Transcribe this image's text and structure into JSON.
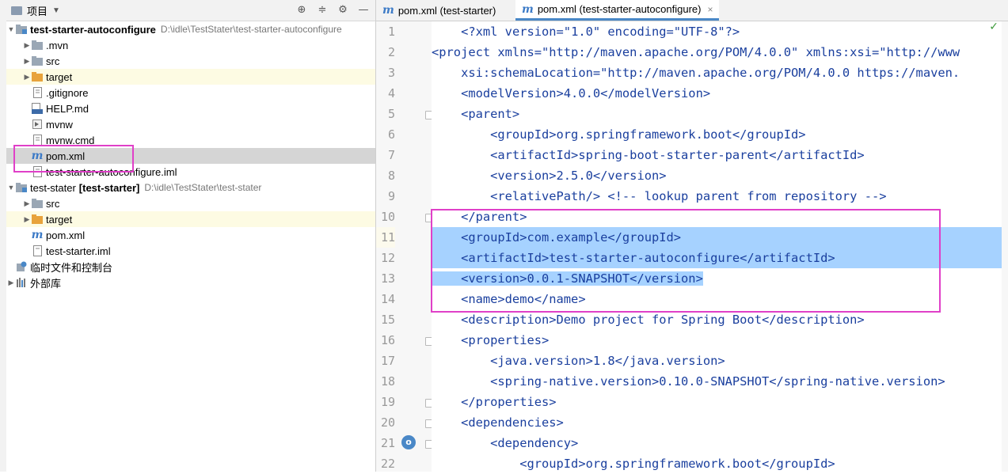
{
  "project_panel": {
    "title": "项目",
    "tree": [
      {
        "label": "test-starter-autoconfigure",
        "path": "D:\\idle\\TestStater\\test-starter-autoconfigure",
        "bold": true
      },
      {
        "label": ".mvn"
      },
      {
        "label": "src"
      },
      {
        "label": "target"
      },
      {
        "label": ".gitignore"
      },
      {
        "label": "HELP.md"
      },
      {
        "label": "mvnw"
      },
      {
        "label": "mvnw.cmd"
      },
      {
        "label": "pom.xml"
      },
      {
        "label": "test-starter-autoconfigure.iml"
      },
      {
        "label": "test-stater",
        "module": "[test-starter]",
        "path": "D:\\idle\\TestStater\\test-stater"
      },
      {
        "label": "src"
      },
      {
        "label": "target"
      },
      {
        "label": "pom.xml"
      },
      {
        "label": "test-starter.iml"
      },
      {
        "label": "临时文件和控制台"
      },
      {
        "label": "外部库"
      }
    ]
  },
  "tabs": [
    {
      "label": "pom.xml (test-starter)",
      "active": false
    },
    {
      "label": "pom.xml (test-starter-autoconfigure)",
      "active": true
    }
  ],
  "editor": {
    "lines": [
      {
        "n": "1",
        "text": "<?xml version=\"1.0\" encoding=\"UTF-8\"?>"
      },
      {
        "n": "2",
        "text": "<project xmlns=\"http://maven.apache.org/POM/4.0.0\" xmlns:xsi=\"http://www"
      },
      {
        "n": "3",
        "text": "    xsi:schemaLocation=\"http://maven.apache.org/POM/4.0.0 https://maven."
      },
      {
        "n": "4",
        "text": "    <modelVersion>4.0.0</modelVersion>"
      },
      {
        "n": "5",
        "text": "    <parent>"
      },
      {
        "n": "6",
        "text": "        <groupId>org.springframework.boot</groupId>"
      },
      {
        "n": "7",
        "text": "        <artifactId>spring-boot-starter-parent</artifactId>"
      },
      {
        "n": "8",
        "text": "        <version>2.5.0</version>"
      },
      {
        "n": "9",
        "text": "        <relativePath/> <!-- lookup parent from repository -->"
      },
      {
        "n": "10",
        "text": "    </parent>"
      },
      {
        "n": "11",
        "text": "    <groupId>com.example</groupId>"
      },
      {
        "n": "12",
        "text": "    <artifactId>test-starter-autoconfigure</artifactId>"
      },
      {
        "n": "13",
        "text": "    <version>0.0.1-SNAPSHOT</version>"
      },
      {
        "n": "14",
        "text": "    <name>demo</name>"
      },
      {
        "n": "15",
        "text": "    <description>Demo project for Spring Boot</description>"
      },
      {
        "n": "16",
        "text": "    <properties>"
      },
      {
        "n": "17",
        "text": "        <java.version>1.8</java.version>"
      },
      {
        "n": "18",
        "text": "        <spring-native.version>0.10.0-SNAPSHOT</spring-native.version>"
      },
      {
        "n": "19",
        "text": "    </properties>"
      },
      {
        "n": "20",
        "text": "    <dependencies>"
      },
      {
        "n": "21",
        "text": "        <dependency>"
      },
      {
        "n": "22",
        "text": "            <groupId>org.springframework.boot</groupId>"
      }
    ]
  },
  "colors": {
    "accent": "#4a88c7",
    "highlight": "#e040c8",
    "selection": "#a6d2ff"
  }
}
